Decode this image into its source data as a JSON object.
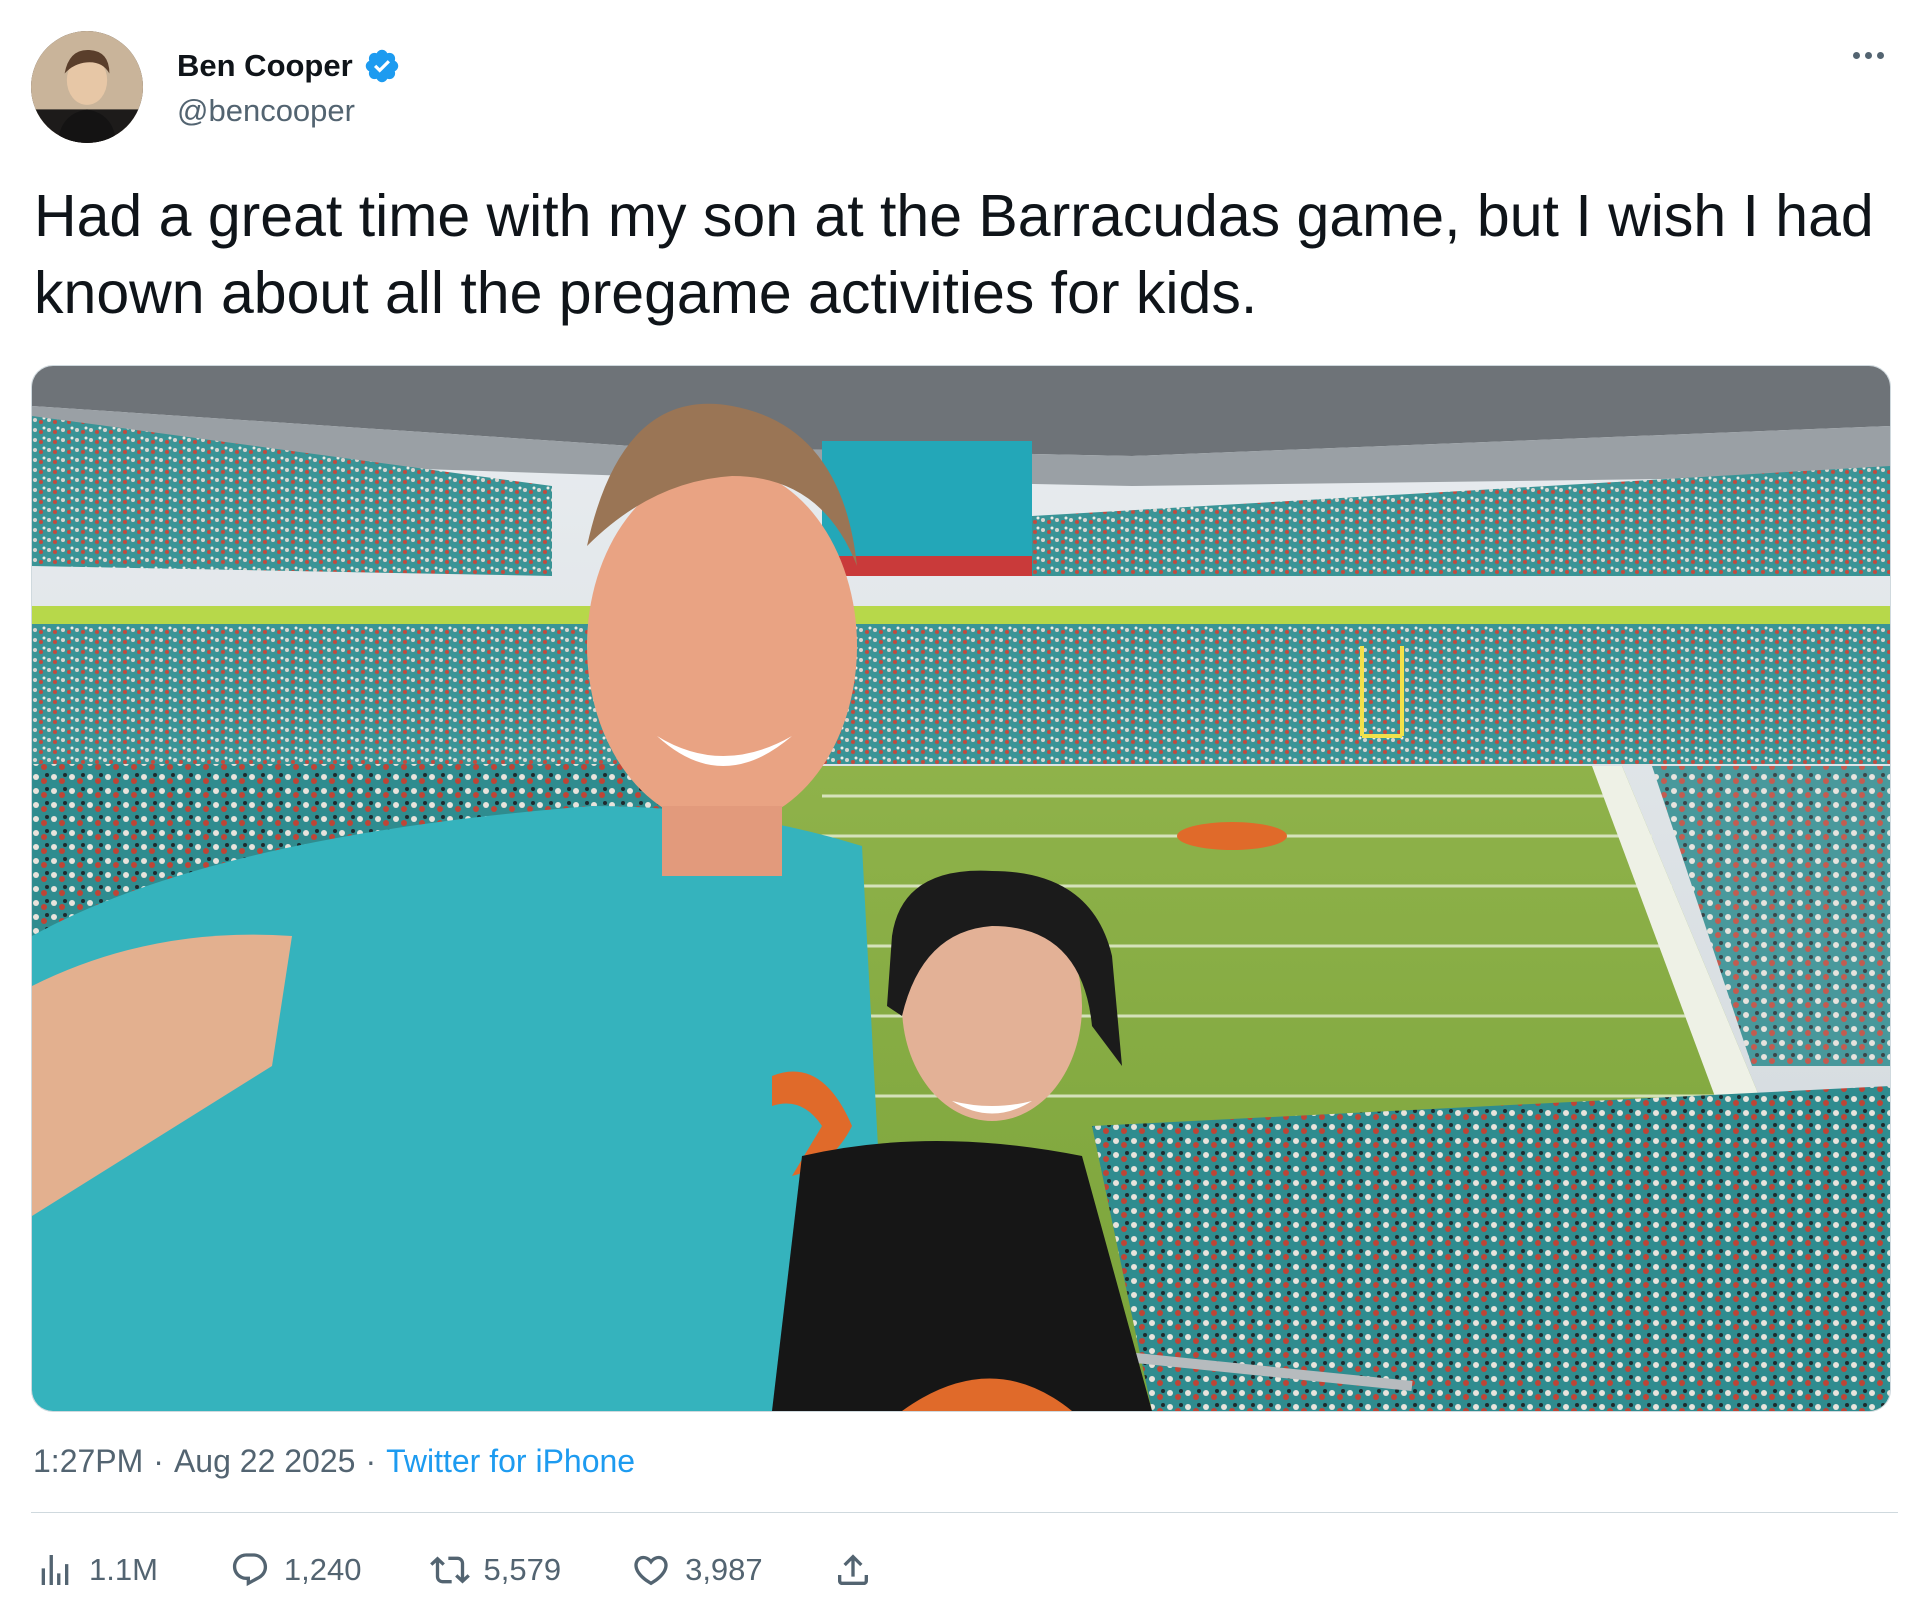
{
  "author": {
    "display_name": "Ben Cooper",
    "handle": "@bencooper",
    "verified": true,
    "avatar_icon": "user-avatar"
  },
  "tweet": {
    "text": "Had a great time with my son at the Barracudas game, but I wish I had known about all the pregame activities for kids."
  },
  "meta": {
    "time": "1:27PM",
    "separator1": "·",
    "date": "Aug 22 2025",
    "separator2": "·",
    "source": "Twitter for iPhone"
  },
  "actions": {
    "views": "1.1M",
    "replies": "1,240",
    "retweets": "5,579",
    "likes": "3,987"
  },
  "colors": {
    "accent": "#1d9bf0",
    "text_primary": "#0f1419",
    "text_secondary": "#536471",
    "divider": "#cfd9de"
  },
  "icons": {
    "more": "more-icon",
    "verified": "verified-badge-icon",
    "views": "views-icon",
    "reply": "reply-icon",
    "retweet": "retweet-icon",
    "like": "heart-icon",
    "share": "share-icon"
  }
}
